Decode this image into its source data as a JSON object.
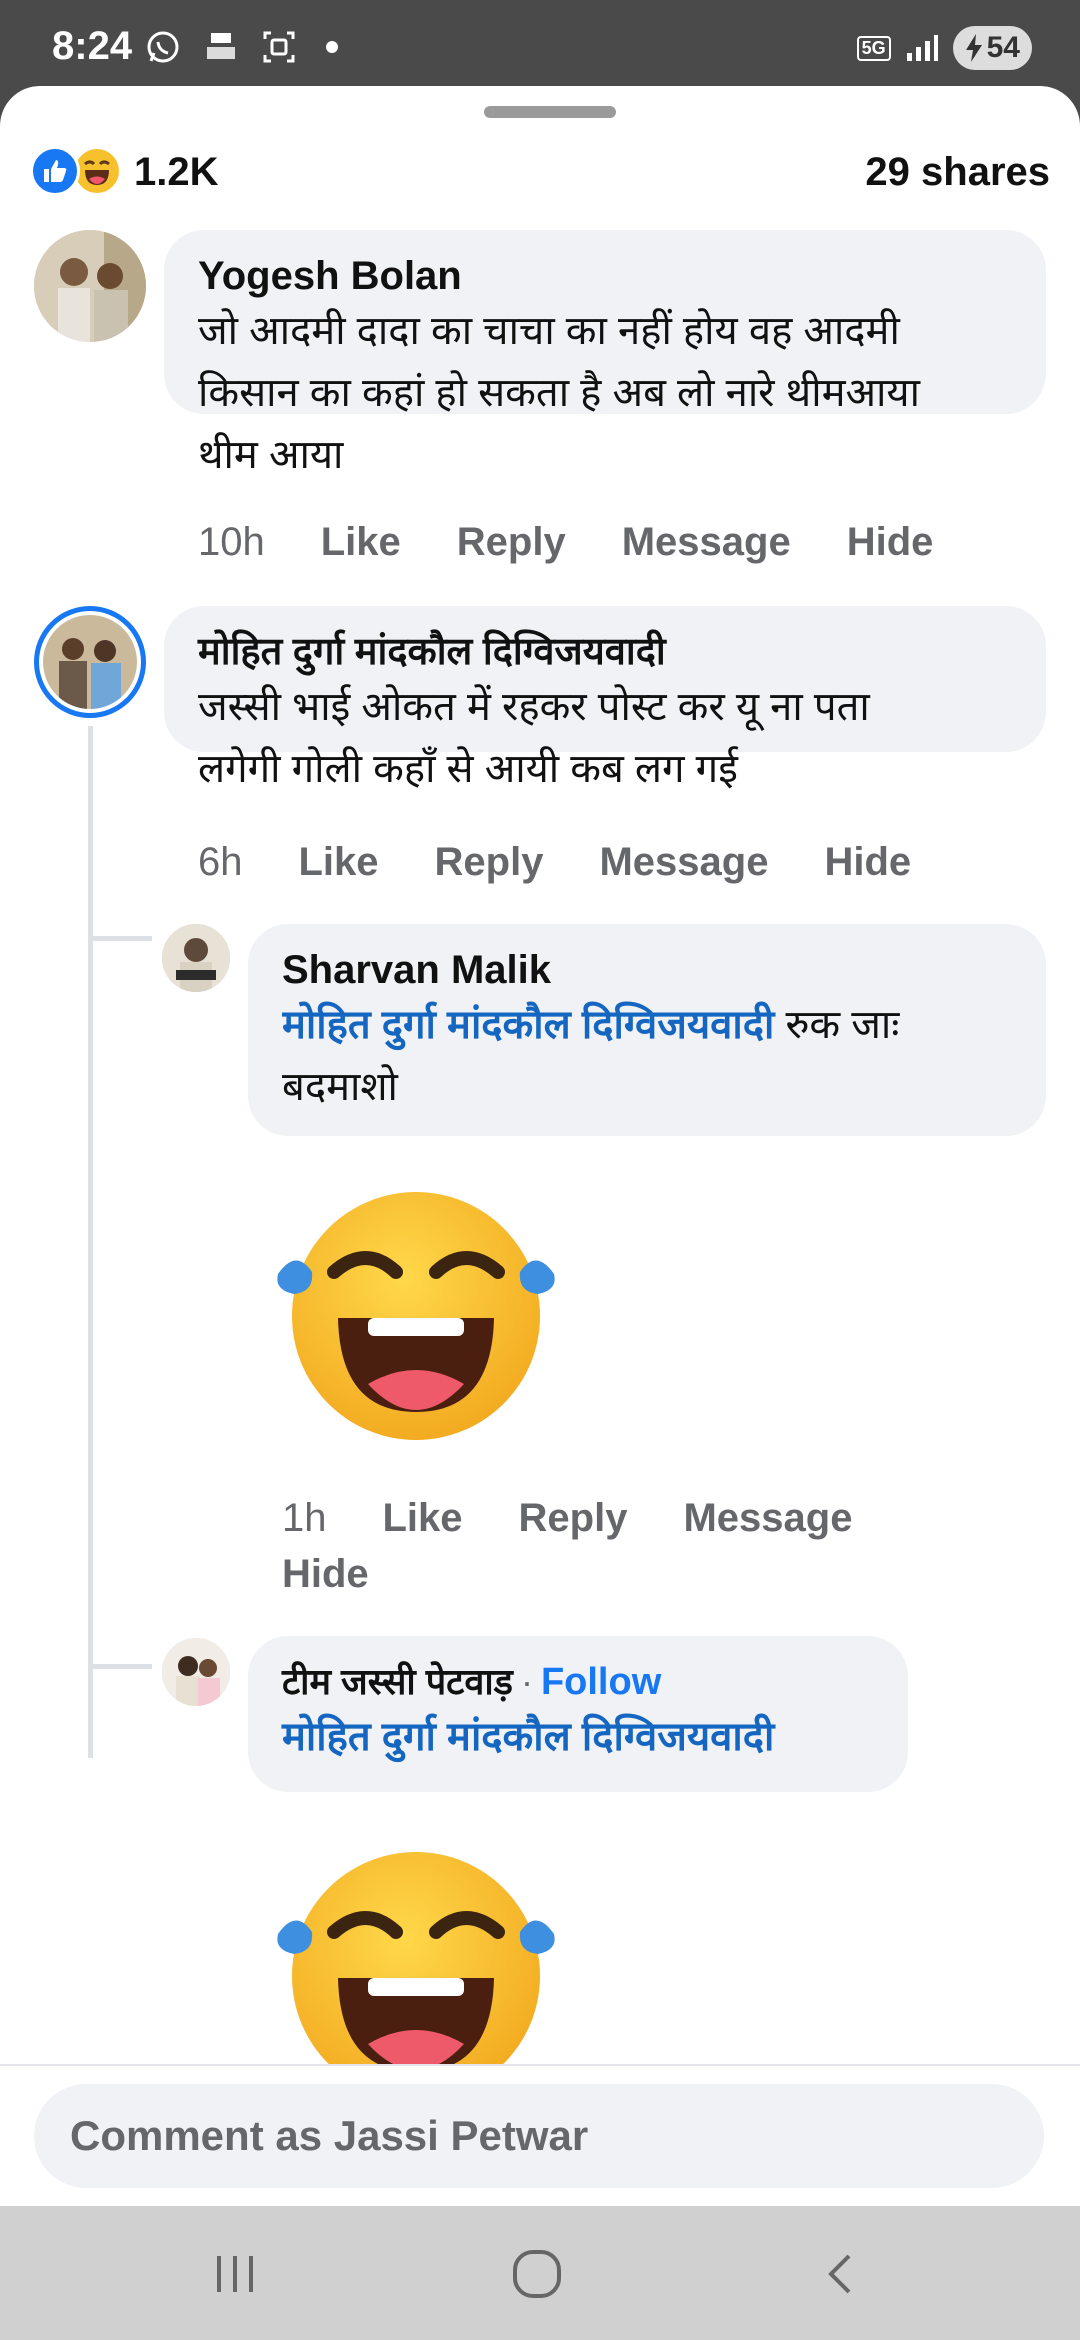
{
  "status_bar": {
    "time": "8:24",
    "network": "5G",
    "battery": "54"
  },
  "summary": {
    "reaction_count": "1.2K",
    "shares": "29 shares"
  },
  "comments": [
    {
      "name": "Yogesh Bolan",
      "text_lines": [
        "जो आदमी दादा का चाचा का नहीं होय वह आदमी",
        "किसान का कहां हो सकता है अब लो नारे थीमआया",
        "थीम आया"
      ],
      "actions": {
        "time": "10h",
        "like": "Like",
        "reply": "Reply",
        "message": "Message",
        "hide": "Hide"
      }
    },
    {
      "name": "मोहित दुर्गा मांदकौल दिग्विजयवादी",
      "text_lines": [
        "जस्सी भाई ओकत में रहकर पोस्ट कर यू ना पता",
        "लगेगी गोली कहाँ से आयी कब लग गई"
      ],
      "actions": {
        "time": "6h",
        "like": "Like",
        "reply": "Reply",
        "message": "Message",
        "hide": "Hide"
      }
    }
  ],
  "replies": [
    {
      "name": "Sharvan Malik",
      "mention": "मोहित दुर्गा मांदकौल दिग्विजयवादी",
      "text_after_mention": " रुक जाः",
      "text_line2": "बदमाशो",
      "actions": {
        "time": "1h",
        "like": "Like",
        "reply": "Reply",
        "message": "Message",
        "hide": "Hide"
      }
    },
    {
      "name": "टीम जस्सी पेटवाड़",
      "separator": "·",
      "follow": "Follow",
      "mention": "मोहित दुर्गा मांदकौल दिग्विजयवादी"
    }
  ],
  "comment_box": {
    "placeholder": "Comment as Jassi Petwar"
  },
  "icons": {
    "reactions": [
      "like-icon",
      "haha-icon"
    ],
    "navigation": [
      "recent-apps-icon",
      "home-icon",
      "back-icon"
    ]
  },
  "colors": {
    "link": "#1566c0",
    "follow": "#1877f2",
    "bubble": "#f0f2f5",
    "secondary_text": "#65676b"
  }
}
